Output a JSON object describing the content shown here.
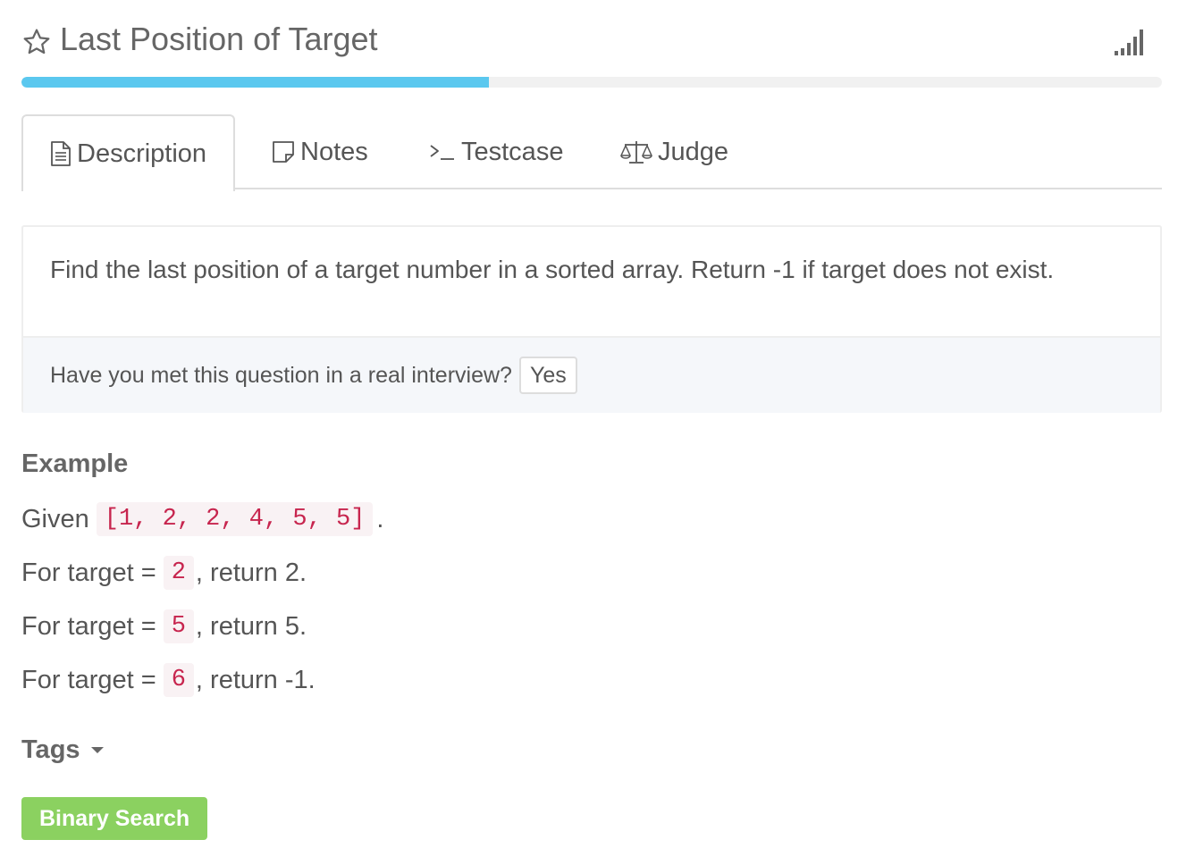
{
  "header": {
    "title": "Last Position of Target",
    "star_icon": "star-outline-icon",
    "difficulty_icon": "signal-bars-icon"
  },
  "progress": {
    "fraction": 0.41,
    "color": "#5bc8ef"
  },
  "tabs": [
    {
      "label": "Description",
      "icon": "document-icon",
      "active": true
    },
    {
      "label": "Notes",
      "icon": "note-icon",
      "active": false
    },
    {
      "label": "Testcase",
      "icon": "terminal-icon",
      "active": false
    },
    {
      "label": "Judge",
      "icon": "scale-icon",
      "active": false
    }
  ],
  "problem": {
    "text": "Find the last position of a target number in a sorted array. Return -1 if target does not exist.",
    "interview_question": "Have you met this question in a real interview?",
    "yes_label": "Yes"
  },
  "example": {
    "title": "Example",
    "given_prefix": "Given",
    "array": "[1, 2, 2, 4, 5, 5]",
    "given_suffix": ".",
    "cases": [
      {
        "prefix": "For target =",
        "target": "2",
        "suffix": ", return 2."
      },
      {
        "prefix": "For target =",
        "target": "5",
        "suffix": ", return 5."
      },
      {
        "prefix": "For target =",
        "target": "6",
        "suffix": ", return -1."
      }
    ]
  },
  "tags": {
    "title": "Tags",
    "items": [
      {
        "label": "Binary Search",
        "color": "#8bd160"
      }
    ]
  }
}
